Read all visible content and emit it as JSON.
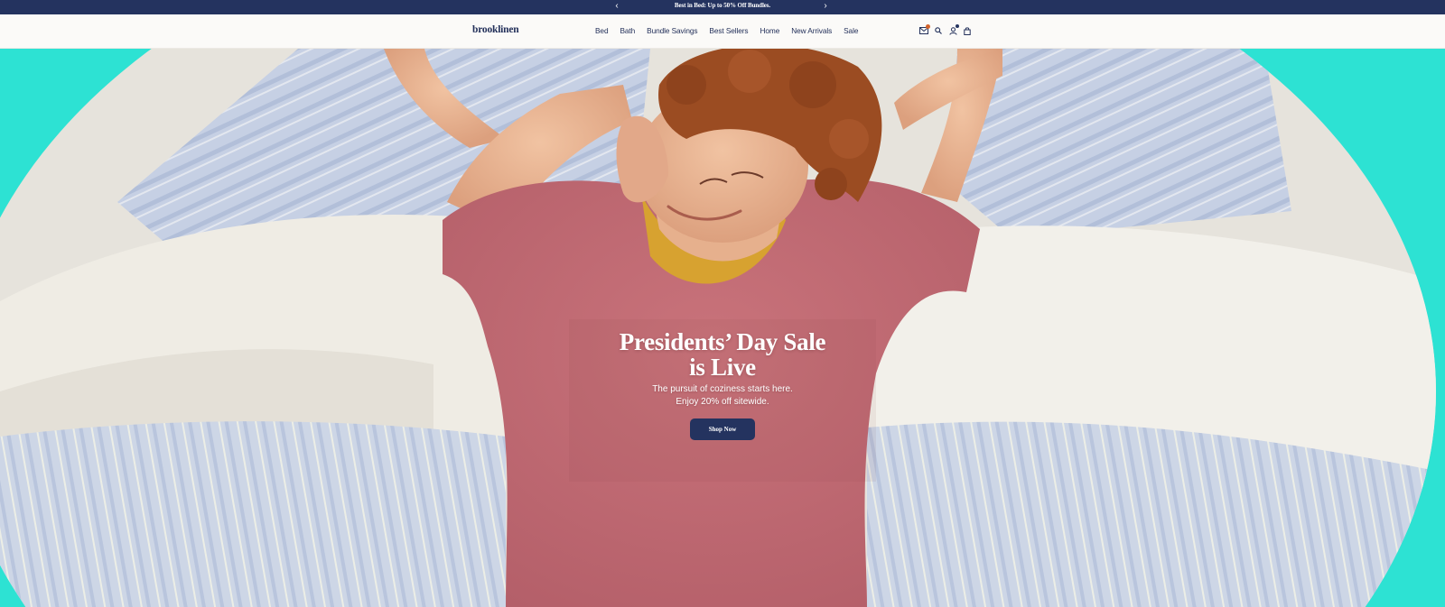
{
  "colors": {
    "announcement_bg": "#24335f",
    "header_bg": "#fbfaf8",
    "brand_navy": "#23305a",
    "hero_accent": "#2de2d3",
    "cart_badge": "#d4632a",
    "account_badge": "#24335f"
  },
  "announcement": {
    "text": "Best in Bed: Up to 50% Off Bundles.",
    "prev_icon": "chevron-left-icon",
    "next_icon": "chevron-right-icon",
    "prev_glyph": "‹",
    "next_glyph": "›"
  },
  "header": {
    "logo": "brooklinen",
    "nav": [
      {
        "label": "Bed"
      },
      {
        "label": "Bath"
      },
      {
        "label": "Bundle Savings"
      },
      {
        "label": "Best Sellers"
      },
      {
        "label": "Home"
      },
      {
        "label": "New Arrivals"
      },
      {
        "label": "Sale"
      }
    ],
    "icons": [
      "mail-icon",
      "search-icon",
      "account-icon",
      "shopping-bag-icon"
    ]
  },
  "hero": {
    "title_line1": "Presidents’ Day Sale",
    "title_line2": "is Live",
    "subtitle_line1": "The pursuit of coziness starts here.",
    "subtitle_line2": "Enjoy 20% off sitewide.",
    "cta": "Shop Now"
  }
}
